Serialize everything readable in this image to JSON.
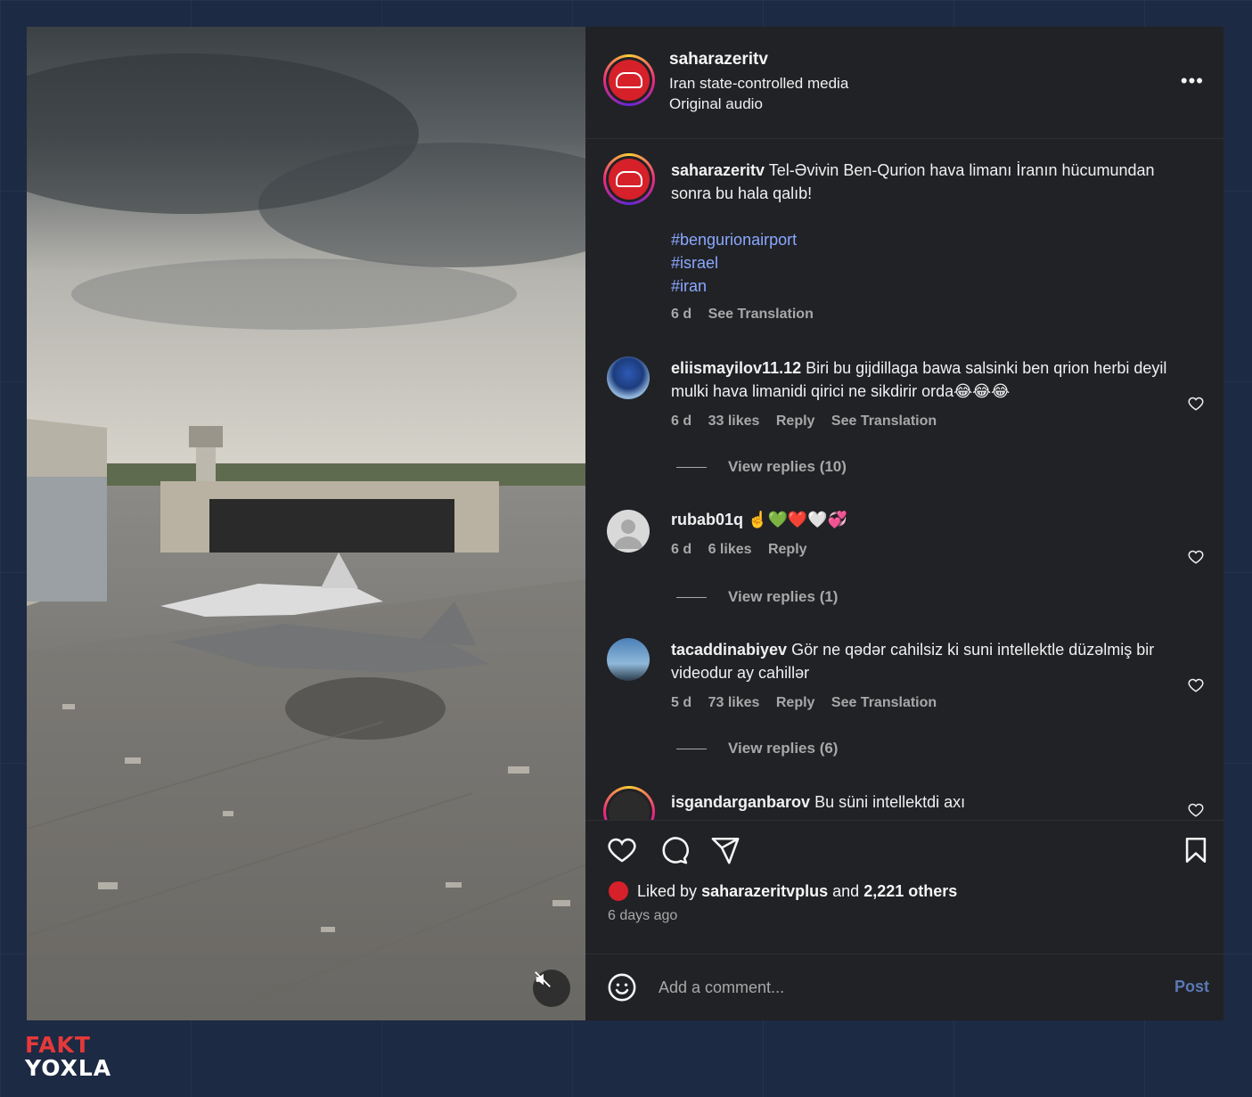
{
  "post": {
    "username": "saharazeritv",
    "label": "Iran state-controlled media",
    "audio": "Original audio",
    "caption_user": "saharazeritv",
    "caption_text": "Tel-Əvivin Ben-Qurion hava limanı İranın hücumundan sonra bu hala qalıb!",
    "hashtags": [
      "#bengurionairport",
      "#israel",
      "#iran"
    ],
    "age": "6 d",
    "see_translation": "See Translation"
  },
  "comments": [
    {
      "user": "eliismayilov11.12",
      "text": "Biri bu gijdillaga bawa salsinki ben qrion herbi deyil mulki hava limanidi qirici ne sikdirir orda😂😂😂",
      "age": "6 d",
      "likes": "33 likes",
      "reply": "Reply",
      "translate": "See Translation",
      "view_replies": "View replies (10)"
    },
    {
      "user": "rubab01q",
      "text": "☝️💚❤️🤍💞",
      "age": "6 d",
      "likes": "6 likes",
      "reply": "Reply",
      "view_replies": "View replies (1)"
    },
    {
      "user": "tacaddinabiyev",
      "text": "Gör ne qədər cahilsiz ki suni intellektle düzəlmiş bir videodur ay cahillər",
      "age": "5 d",
      "likes": "73 likes",
      "reply": "Reply",
      "translate": "See Translation",
      "view_replies": "View replies (6)"
    },
    {
      "user": "isgandarganbarov",
      "text": "Bu süni intellektdi axı"
    }
  ],
  "likes": {
    "prefix": "Liked by",
    "user": "saharazeritvplus",
    "middle": "and",
    "others": "2,221 others",
    "time_ago": "6 days ago"
  },
  "composer": {
    "placeholder": "Add a comment...",
    "post_label": "Post"
  },
  "watermark": {
    "line1": "FAKT",
    "line2": "YOXLA"
  },
  "colors": {
    "background": "#1d2a44",
    "panel": "#212226",
    "hashtag": "#8aa8ff",
    "brand_red": "#d6202a"
  },
  "icons": [
    "more-icon",
    "heart-icon",
    "comment-icon",
    "share-icon",
    "bookmark-icon",
    "emoji-icon",
    "mute-icon"
  ]
}
